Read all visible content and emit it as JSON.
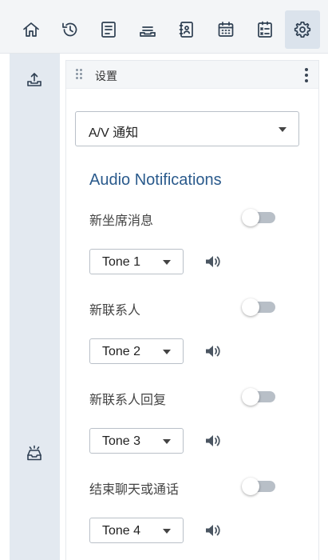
{
  "toolbar": {
    "icons": [
      "home-icon",
      "history-icon",
      "document-icon",
      "inbox-tray-icon",
      "contacts-book-icon",
      "calendar-icon",
      "task-checklist-icon",
      "gear-icon"
    ],
    "active": "gear-icon"
  },
  "sidebar": {
    "icons": [
      "upload-tray-icon",
      "inbox-tray-icon"
    ]
  },
  "panel": {
    "title": "设置",
    "category_select": {
      "value": "A/V 通知"
    },
    "section_title": "Audio Notifications",
    "notifications": [
      {
        "label": "新坐席消息",
        "enabled": false,
        "tone": "Tone 1"
      },
      {
        "label": "新联系人",
        "enabled": false,
        "tone": "Tone 2"
      },
      {
        "label": "新联系人回复",
        "enabled": false,
        "tone": "Tone 3"
      },
      {
        "label": "结束聊天或通话",
        "enabled": false,
        "tone": "Tone 4"
      }
    ]
  },
  "colors": {
    "accent": "#2a5a8c",
    "toolbar_bg": "#f3f5f7",
    "sidebar_bg": "#e3e9f0",
    "toggle_off": "#b8bfc7"
  }
}
